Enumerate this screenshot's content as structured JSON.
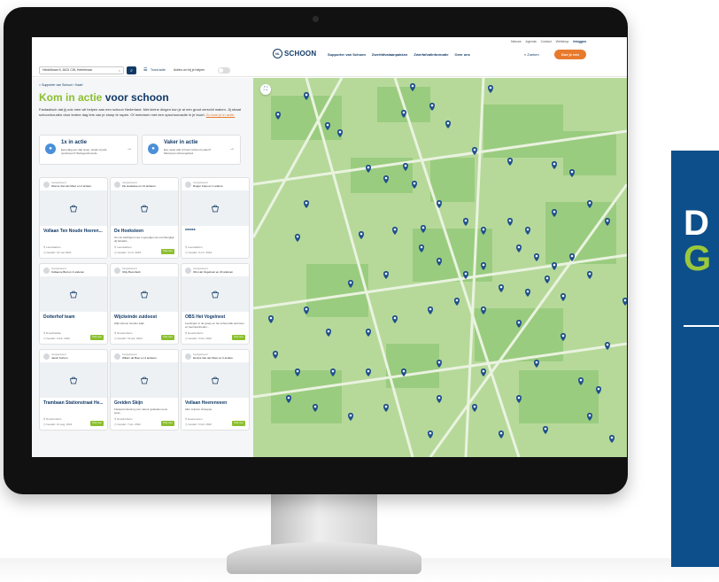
{
  "header": {
    "util_links": [
      "Nieuws",
      "Agenda",
      "Contact",
      "Webshop",
      "Inloggen"
    ],
    "logo_badge": "NL",
    "logo_text": "SCHOON",
    "nav": [
      "Supporter van Schoon",
      "Zwerfafvalaanpakken",
      "Zwerfafvalinformatie",
      "Over ons"
    ],
    "search_label": "Zoeken",
    "cta_label": "Doe je een"
  },
  "filter": {
    "location": "Heidelbaan 6, 6431 CW, Heerlenaar",
    "toggle_label": "Acties om bij je helpen"
  },
  "page": {
    "breadcrumb": "Supporter van Schoon  ›  Kaart",
    "title_main": "Kom in actie ",
    "title_accent": "voor schoon",
    "intro": "Fantastisch dat jij ook mee wil helpen aan een schoon Nederland. Met kleine dingen kun je al een groot verschil maken. Jij straat schoonhouden door iedere dag iets van je stoep te rapen. Of meedoen met een opschoonactie in je buurt. ",
    "intro_link": "Zo kom je in actie."
  },
  "action_cards": [
    {
      "title": "1x in actie",
      "text": "Eenmalig een dak stoep, straat of park opschonen? Werkgeschoonde."
    },
    {
      "title": "Vaker in actie",
      "text": "Een vaste wijk of buurt schoon houden? Meld jouw schoongebied."
    }
  ],
  "cards": [
    {
      "org_label": "Georganiseerd",
      "org": "Wonne Van der Meer en 2 andere",
      "title": "Vollaan Ten Noude Heeren...",
      "desc": "",
      "loc": "Leeuwarden",
      "date": "Gestart: 16 mei 2022",
      "btn": ""
    },
    {
      "org_label": "Georganiseerd",
      "org": "Zie Hoekstee en 14 anderen",
      "title": "De Hoeksteen",
      "desc": "Om de sachtigen mee in gevolgen de eet tiltengligt dij bardelis...",
      "loc": "Leeuwarden",
      "date": "Gestart: 4 mrt. 2022",
      "btn": "Help mee"
    },
    {
      "org_label": "Georganiseerd",
      "org": "Rutger Kups en 1 andere",
      "title": "******",
      "desc": "",
      "loc": "Leeuwarden",
      "date": "Gestart: 6 mrt. 2022",
      "btn": ""
    },
    {
      "org_label": "Georganiseerd",
      "org": "Kollaeme Bud en 4 anderen",
      "title": "Dotterhof team",
      "desc": "",
      "loc": "Noordhelden",
      "date": "Gestart: 6 feb. 2022",
      "btn": "Help mee"
    },
    {
      "org_label": "Georganiseerd",
      "org": "Oldy Boomberk",
      "title": "Wijckeinde zuidoost",
      "desc": "Wijk schoon houden lelijk",
      "loc": "Noorderhelm",
      "date": "Gestart: 19 apr. 2022",
      "btn": "Help mee"
    },
    {
      "org_label": "Georganiseerd",
      "org": "Obs Het Vogelnest en 20 anderen",
      "title": "OBS Het Vogelnest",
      "desc": "Leerlingen in de groep en het school alle terreinen en leerzaamheden...",
      "loc": "Noorderhelm",
      "date": "Gestart: 6 feb. 2022",
      "btn": "Help mee"
    },
    {
      "org_label": "Georganiseerd",
      "org": "Jacob Kortum",
      "title": "Trambaan Stationstraat He...",
      "desc": "",
      "loc": "Noorderhelm",
      "date": "Gestart: 12 aug. 2022",
      "btn": "Help mee"
    },
    {
      "org_label": "Georganiseerd",
      "org": "Willem de Boer en 3 anderen",
      "title": "Greiden Skijn",
      "desc": "Fietspad cleaning over natuur gebieden eens weer...",
      "loc": "Noorderhelm",
      "date": "Gestart: 7 jan. 2022",
      "btn": "Help mee"
    },
    {
      "org_label": "Georganiseerd",
      "org": "Dennis Van der Meer en 2 andere",
      "title": "Vollaan Heerenveen",
      "desc": "Aller sciptum shieeppe",
      "loc": "Heerenveen",
      "date": "Gestart: 6 feb. 2022",
      "btn": "Help mee"
    }
  ],
  "side_banner": {
    "line1": "D",
    "line2": "G"
  },
  "colors": {
    "navy": "#123a66",
    "green": "#8bbf2f",
    "orange": "#e87a2d",
    "banner": "#0d4f8b",
    "map": "#b6d99a"
  }
}
